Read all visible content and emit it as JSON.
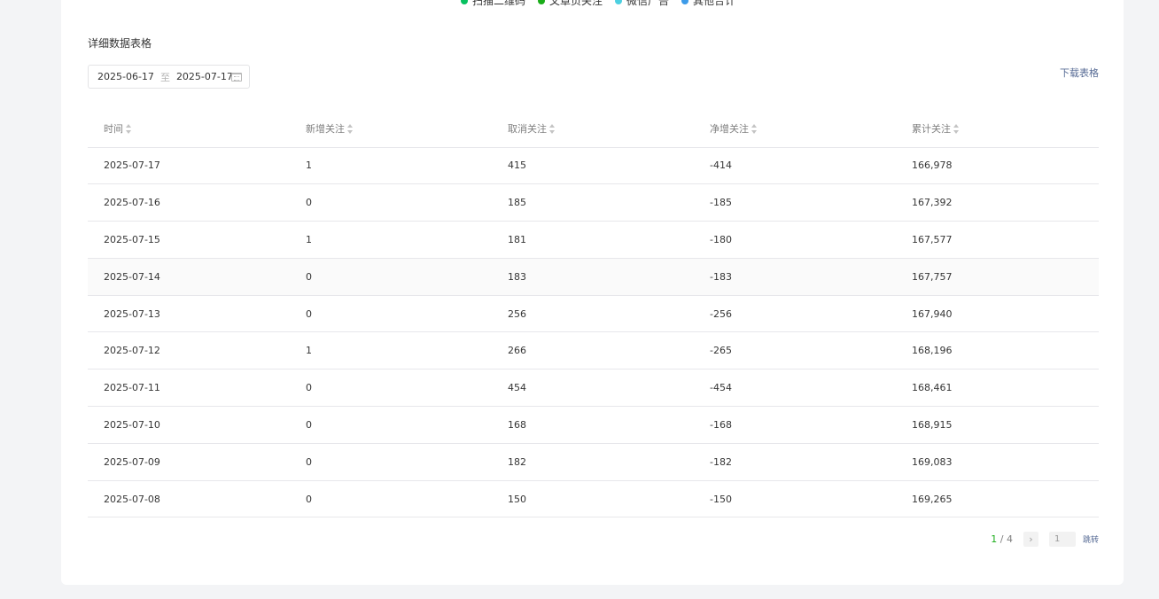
{
  "legend": [
    {
      "label": "扫描二维码",
      "color": "#07c160"
    },
    {
      "label": "文章页关注",
      "color": "#1aad19"
    },
    {
      "label": "微信广告",
      "color": "#4dd0e1"
    },
    {
      "label": "其他合计",
      "color": "#3d9be9"
    }
  ],
  "section_title": "详细数据表格",
  "date_range": {
    "start": "2025-06-17",
    "separator": "至",
    "end": "2025-07-17"
  },
  "download_label": "下载表格",
  "table": {
    "headers": [
      "时间",
      "新增关注",
      "取消关注",
      "净增关注",
      "累计关注"
    ],
    "rows": [
      [
        "2025-07-17",
        "1",
        "415",
        "-414",
        "166,978"
      ],
      [
        "2025-07-16",
        "0",
        "185",
        "-185",
        "167,392"
      ],
      [
        "2025-07-15",
        "1",
        "181",
        "-180",
        "167,577"
      ],
      [
        "2025-07-14",
        "0",
        "183",
        "-183",
        "167,757"
      ],
      [
        "2025-07-13",
        "0",
        "256",
        "-256",
        "167,940"
      ],
      [
        "2025-07-12",
        "1",
        "266",
        "-265",
        "168,196"
      ],
      [
        "2025-07-11",
        "0",
        "454",
        "-454",
        "168,461"
      ],
      [
        "2025-07-10",
        "0",
        "168",
        "-168",
        "168,915"
      ],
      [
        "2025-07-09",
        "0",
        "182",
        "-182",
        "169,083"
      ],
      [
        "2025-07-08",
        "0",
        "150",
        "-150",
        "169,265"
      ]
    ]
  },
  "pagination": {
    "current": "1",
    "separator": " / ",
    "total": "4",
    "next_glyph": "›",
    "input_value": "1",
    "jump_label": "跳转"
  }
}
